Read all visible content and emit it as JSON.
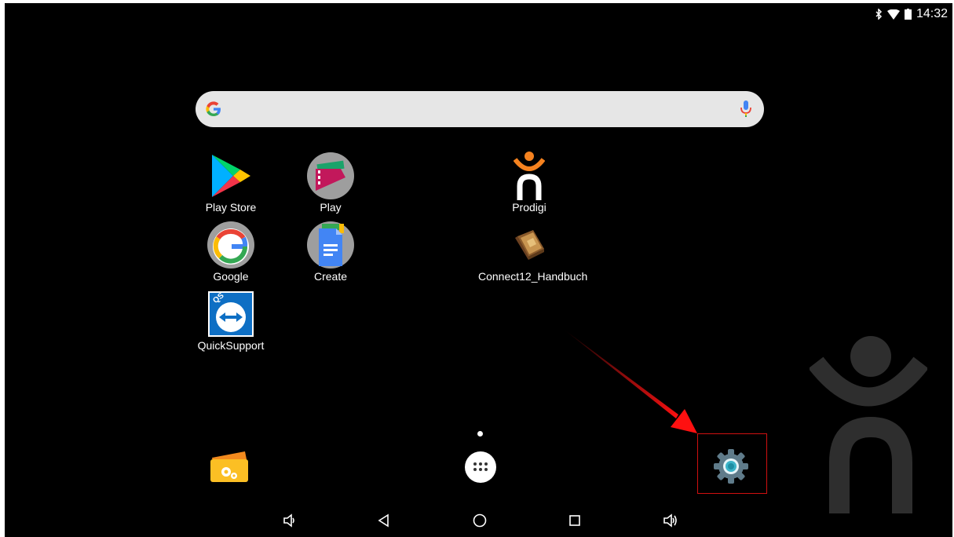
{
  "status_bar": {
    "time": "14:32",
    "icons": [
      "bluetooth-icon",
      "wifi-icon",
      "battery-icon"
    ]
  },
  "search": {
    "provider_icon": "google-g-icon",
    "voice_icon": "mic-icon"
  },
  "apps": [
    {
      "label": "Play Store",
      "icon": "play-store-icon"
    },
    {
      "label": "Play",
      "icon": "play-movies-icon"
    },
    {
      "label": "Prodigi",
      "icon": "prodigi-icon"
    },
    {
      "label": "Google",
      "icon": "google-icon"
    },
    {
      "label": "Create",
      "icon": "docs-icon"
    },
    {
      "label": "Connect12_Handbuch",
      "icon": "book-icon"
    },
    {
      "label": "QuickSupport",
      "icon": "quicksupport-icon"
    }
  ],
  "dock": {
    "items": [
      "wallet-settings-icon",
      "app-drawer-icon",
      "settings-gear-icon"
    ],
    "highlight_color": "#d01010"
  },
  "nav_bar": {
    "buttons": [
      "volume-down-icon",
      "back-icon",
      "home-icon",
      "recents-icon",
      "volume-up-icon"
    ]
  },
  "colors": {
    "screen_bg": "#000000",
    "search_bg": "#e6e6e6",
    "annotation_arrow": "#d01010"
  }
}
